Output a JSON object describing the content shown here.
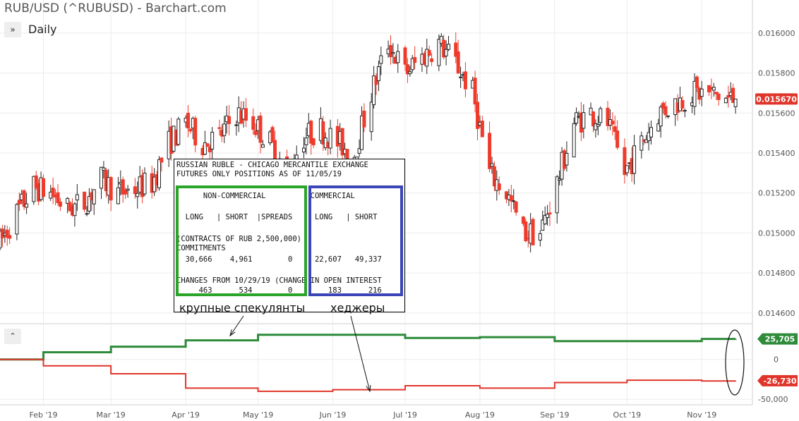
{
  "header": {
    "title": "RUB/USD (^RUBUSD) - Barchart.com",
    "period_icon": "double-chevron-right-icon",
    "period_label": "Daily",
    "collapse_icon": "chevron-up-icon"
  },
  "colors": {
    "up": "#222222",
    "down": "#ee3b2b",
    "noncommercial_line": "#2e8b3a",
    "commercial_line": "#e0352a",
    "price_tag": "#e0352a",
    "green_box": "#2aa52a",
    "blue_box": "#3b45b8"
  },
  "chart_data": [
    {
      "type": "candlestick",
      "title": "RUB/USD (^RUBUSD) - Barchart.com",
      "period": "Daily",
      "x_axis": {
        "tick_labels": [
          "Feb '19",
          "Mar '19",
          "Apr '19",
          "May '19",
          "Jun '19",
          "Jul '19",
          "Aug '19",
          "Sep '19",
          "Oct '19",
          "Nov '19"
        ],
        "tick_dates": [
          "2019-02-01",
          "2019-03-01",
          "2019-04-01",
          "2019-05-01",
          "2019-06-01",
          "2019-07-01",
          "2019-08-01",
          "2019-09-01",
          "2019-10-01",
          "2019-11-01"
        ],
        "range": [
          "2019-01-14",
          "2019-11-22"
        ]
      },
      "y_axis": {
        "tick_labels": [
          "0.016000",
          "0.015800",
          "0.015600",
          "0.015400",
          "0.015200",
          "0.015000",
          "0.014800",
          "0.014600"
        ],
        "range": [
          0.01455,
          0.01613
        ],
        "position": "right"
      },
      "last_price_label": "0.015670",
      "last_price": 0.01567,
      "grid": true,
      "weekly_approx_closes": [
        {
          "date": "2019-01-14",
          "close": 0.01495
        },
        {
          "date": "2019-01-21",
          "close": 0.0151
        },
        {
          "date": "2019-01-28",
          "close": 0.01523
        },
        {
          "date": "2019-02-04",
          "close": 0.0152
        },
        {
          "date": "2019-02-11",
          "close": 0.01512
        },
        {
          "date": "2019-02-18",
          "close": 0.01515
        },
        {
          "date": "2019-02-25",
          "close": 0.01527
        },
        {
          "date": "2019-03-04",
          "close": 0.0152
        },
        {
          "date": "2019-03-11",
          "close": 0.01522
        },
        {
          "date": "2019-03-18",
          "close": 0.01525
        },
        {
          "date": "2019-03-25",
          "close": 0.01545
        },
        {
          "date": "2019-04-01",
          "close": 0.01555
        },
        {
          "date": "2019-04-08",
          "close": 0.01545
        },
        {
          "date": "2019-04-15",
          "close": 0.01548
        },
        {
          "date": "2019-04-22",
          "close": 0.0156
        },
        {
          "date": "2019-04-29",
          "close": 0.01555
        },
        {
          "date": "2019-05-06",
          "close": 0.01545
        },
        {
          "date": "2019-05-13",
          "close": 0.0153
        },
        {
          "date": "2019-05-20",
          "close": 0.01548
        },
        {
          "date": "2019-05-27",
          "close": 0.01552
        },
        {
          "date": "2019-06-03",
          "close": 0.01545
        },
        {
          "date": "2019-06-10",
          "close": 0.0154
        },
        {
          "date": "2019-06-17",
          "close": 0.0157
        },
        {
          "date": "2019-06-24",
          "close": 0.01595
        },
        {
          "date": "2019-07-01",
          "close": 0.0158
        },
        {
          "date": "2019-07-08",
          "close": 0.01588
        },
        {
          "date": "2019-07-15",
          "close": 0.01595
        },
        {
          "date": "2019-07-22",
          "close": 0.01585
        },
        {
          "date": "2019-07-29",
          "close": 0.0157
        },
        {
          "date": "2019-08-05",
          "close": 0.0153
        },
        {
          "date": "2019-08-12",
          "close": 0.0152
        },
        {
          "date": "2019-08-19",
          "close": 0.015
        },
        {
          "date": "2019-08-26",
          "close": 0.015
        },
        {
          "date": "2019-09-02",
          "close": 0.01525
        },
        {
          "date": "2019-09-09",
          "close": 0.01555
        },
        {
          "date": "2019-09-16",
          "close": 0.0156
        },
        {
          "date": "2019-09-23",
          "close": 0.01555
        },
        {
          "date": "2019-09-30",
          "close": 0.0153
        },
        {
          "date": "2019-10-07",
          "close": 0.01545
        },
        {
          "date": "2019-10-14",
          "close": 0.0156
        },
        {
          "date": "2019-10-21",
          "close": 0.01565
        },
        {
          "date": "2019-10-28",
          "close": 0.0157
        },
        {
          "date": "2019-11-04",
          "close": 0.0157
        },
        {
          "date": "2019-11-11",
          "close": 0.01567
        }
      ]
    },
    {
      "type": "line",
      "x_axis": {
        "range": [
          "2019-01-14",
          "2019-11-22"
        ]
      },
      "y_axis": {
        "tick_labels": [
          "0",
          "-50,000"
        ],
        "range": [
          -56000,
          44000
        ],
        "position": "right"
      },
      "series": [
        {
          "color": "#2e8b3a",
          "last_value_label": "25,705",
          "points": [
            {
              "date": "2019-01-14",
              "value": 0
            },
            {
              "date": "2019-02-01",
              "value": 9000
            },
            {
              "date": "2019-03-01",
              "value": 16000
            },
            {
              "date": "2019-04-01",
              "value": 24000
            },
            {
              "date": "2019-05-01",
              "value": 31000
            },
            {
              "date": "2019-06-01",
              "value": 31000
            },
            {
              "date": "2019-07-01",
              "value": 27000
            },
            {
              "date": "2019-08-01",
              "value": 28000
            },
            {
              "date": "2019-09-01",
              "value": 23000
            },
            {
              "date": "2019-10-01",
              "value": 23000
            },
            {
              "date": "2019-11-01",
              "value": 25700
            },
            {
              "date": "2019-11-15",
              "value": 25705
            }
          ]
        },
        {
          "color": "#e0352a",
          "last_value_label": "-26,730",
          "points": [
            {
              "date": "2019-01-14",
              "value": 0
            },
            {
              "date": "2019-02-01",
              "value": -8000
            },
            {
              "date": "2019-03-01",
              "value": -18000
            },
            {
              "date": "2019-04-01",
              "value": -36000
            },
            {
              "date": "2019-05-01",
              "value": -40000
            },
            {
              "date": "2019-06-01",
              "value": -38000
            },
            {
              "date": "2019-07-01",
              "value": -33000
            },
            {
              "date": "2019-08-01",
              "value": -36000
            },
            {
              "date": "2019-09-01",
              "value": -29000
            },
            {
              "date": "2019-10-01",
              "value": -26000
            },
            {
              "date": "2019-11-01",
              "value": -27000
            },
            {
              "date": "2019-11-15",
              "value": -26730
            }
          ]
        }
      ]
    }
  ],
  "cot_report": {
    "lines": [
      "RUSSIAN RUBLE - CHICAGO MERCANTILE EXCHANGE",
      "FUTURES ONLY POSITIONS AS OF 11/05/19",
      "      NON-COMMERCIAL          COMMERCIAL",
      "  LONG   | SHORT  |SPREADS     LONG   | SHORT",
      "(CONTRACTS OF RUB 2,500,000)",
      "COMMITMENTS",
      "  30,666    4,961        0     22,607   49,337",
      "CHANGES FROM 10/29/19 (CHANGE IN OPEN INTEREST",
      "     463      534        0        183      216"
    ]
  },
  "annotations": {
    "speculators": "крупные спекулянты",
    "hedgers": "хеджеры"
  }
}
